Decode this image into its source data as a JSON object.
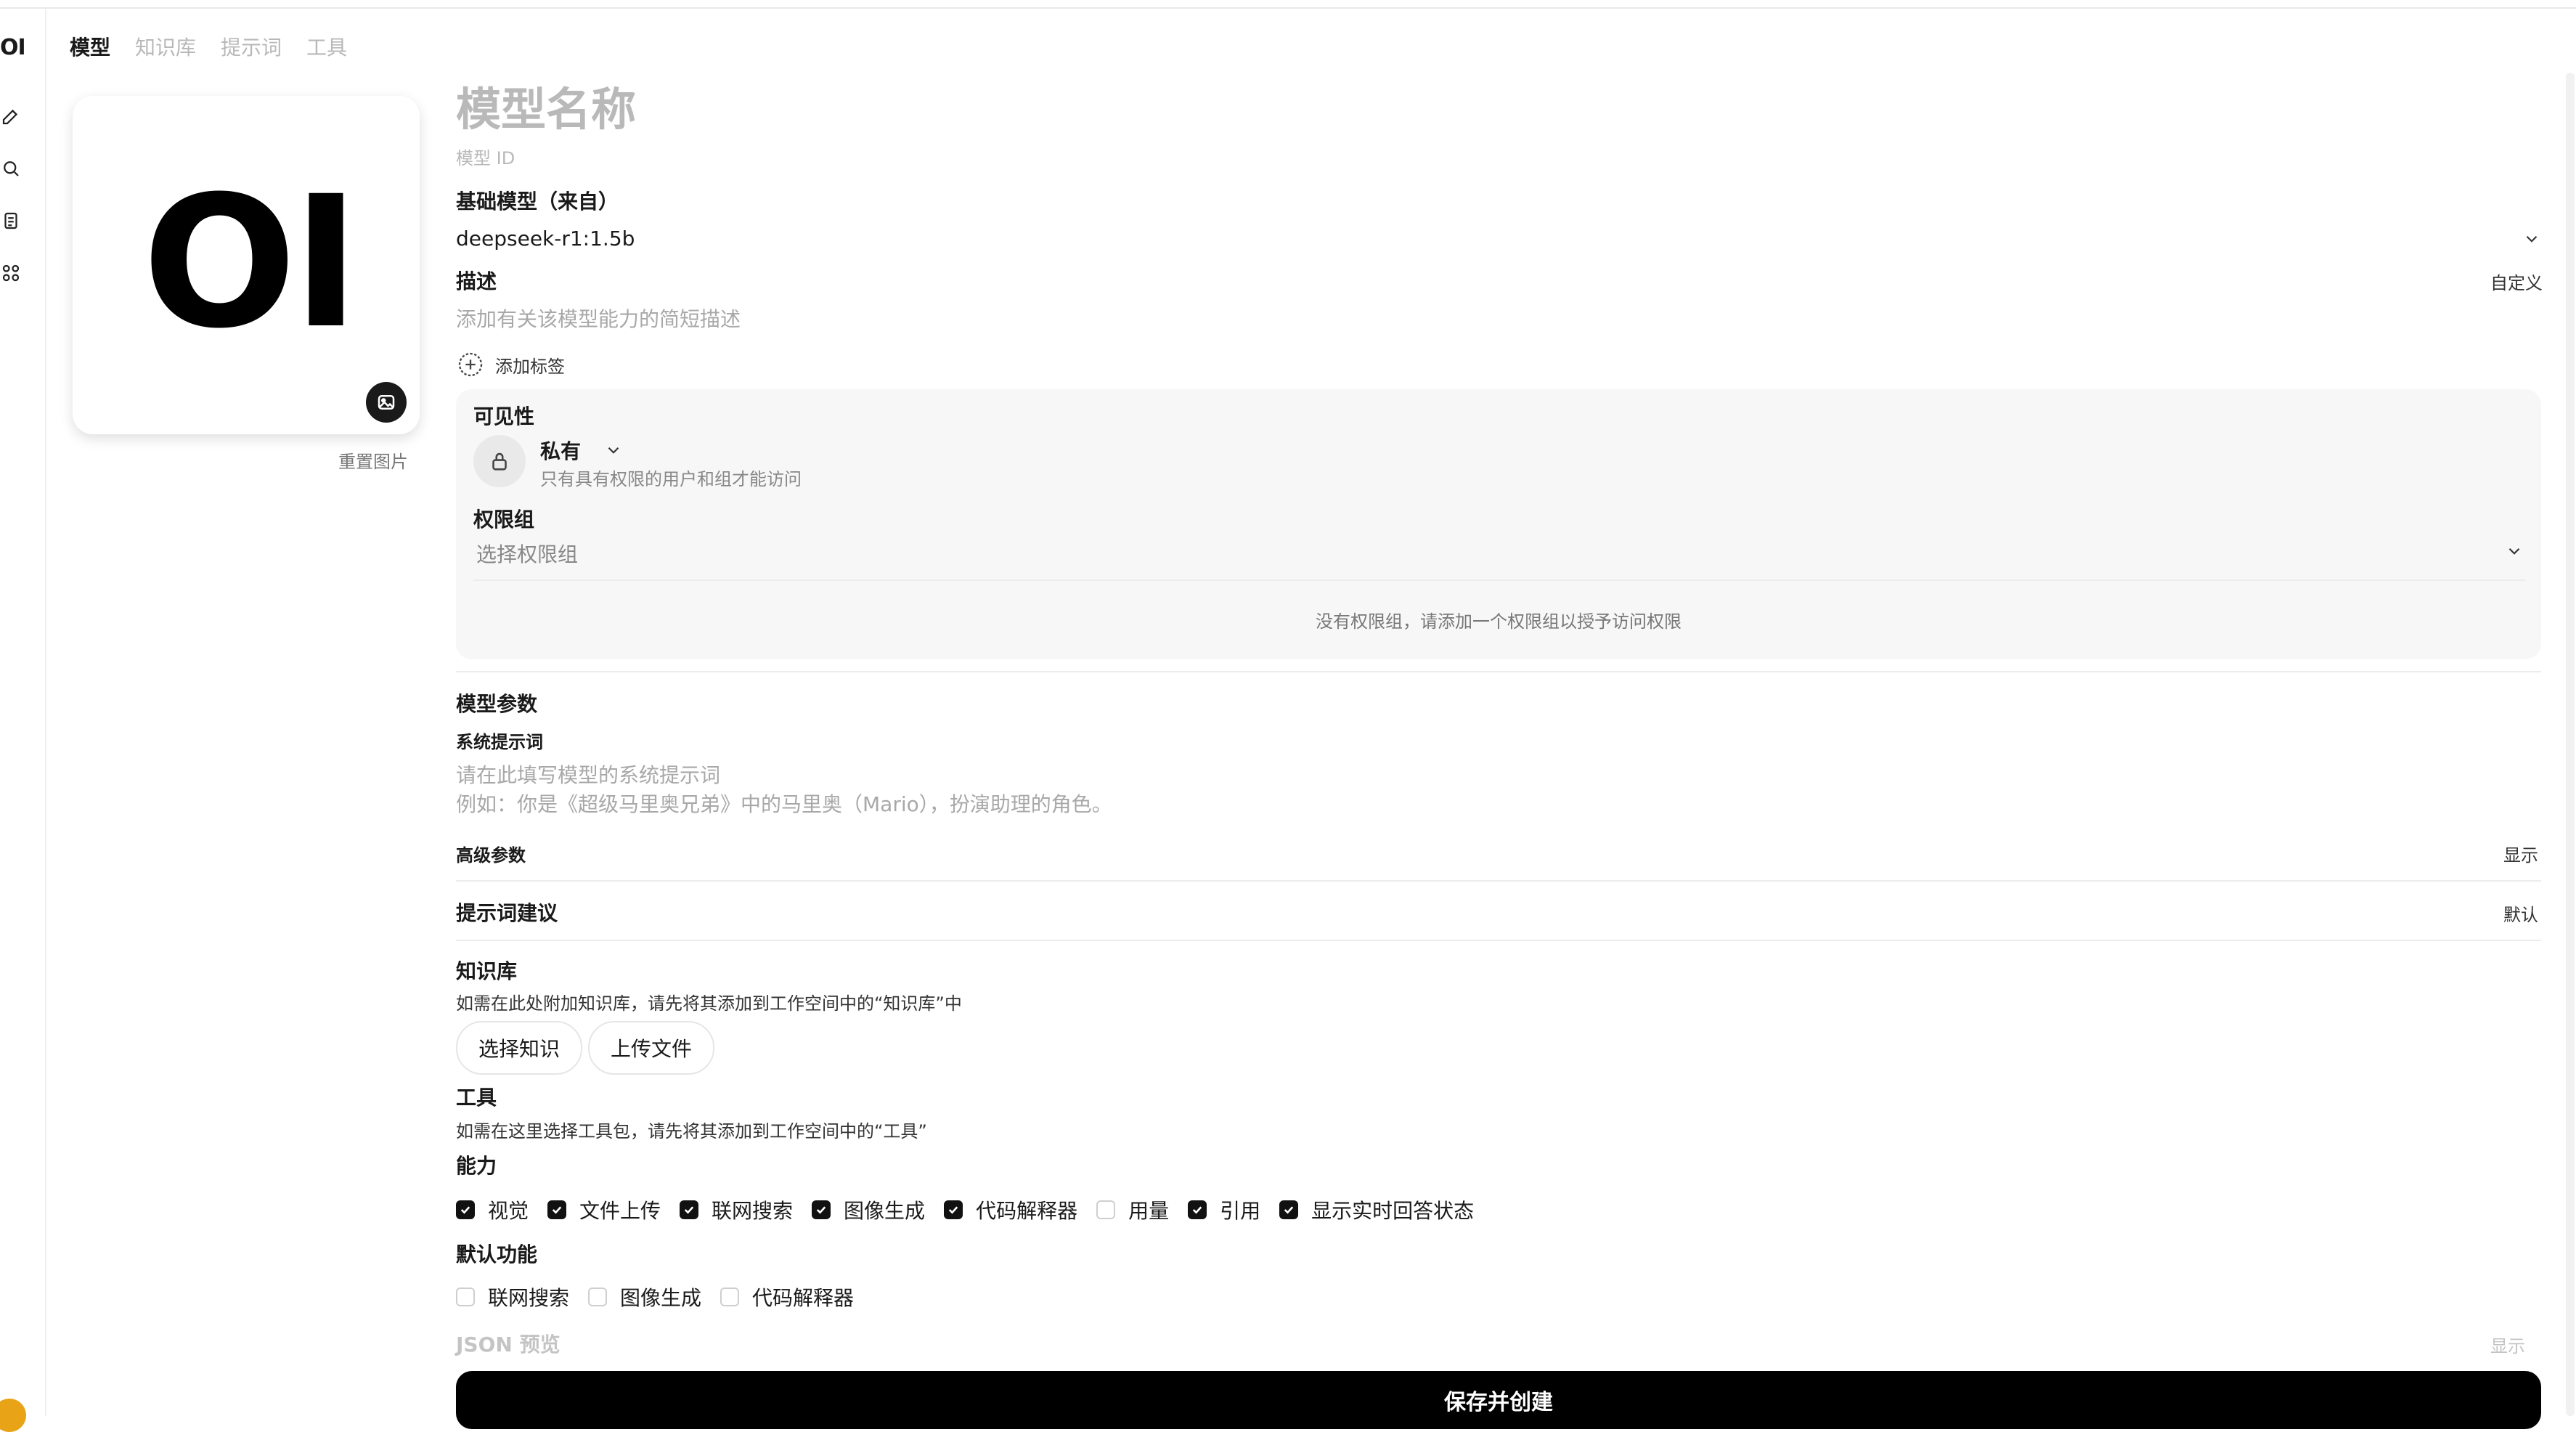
{
  "rail": {
    "logo": "OI",
    "icons": [
      "edit-icon",
      "search-icon",
      "notes-icon",
      "apps-icon"
    ]
  },
  "tabs": [
    {
      "label": "模型",
      "active": true
    },
    {
      "label": "知识库",
      "active": false
    },
    {
      "label": "提示词",
      "active": false
    },
    {
      "label": "工具",
      "active": false
    }
  ],
  "avatar": {
    "logo_text": "OI",
    "reset_label": "重置图片"
  },
  "form": {
    "name_placeholder": "模型名称",
    "id_placeholder": "模型 ID",
    "base_model_label": "基础模型（来自）",
    "base_model_value": "deepseek-r1:1.5b",
    "description_label": "描述",
    "description_mode": "自定义",
    "description_placeholder": "添加有关该模型能力的简短描述",
    "add_tag_label": "添加标签"
  },
  "visibility": {
    "label": "可见性",
    "value": "私有",
    "hint": "只有具有权限的用户和组才能访问",
    "group_label": "权限组",
    "group_placeholder": "选择权限组",
    "empty_text": "没有权限组，请添加一个权限组以授予访问权限"
  },
  "params": {
    "section_label": "模型参数",
    "system_prompt_label": "系统提示词",
    "system_prompt_placeholder": "请在此填写模型的系统提示词\n例如：你是《超级马里奥兄弟》中的马里奥（Mario），扮演助理的角色。",
    "advanced_label": "高级参数",
    "advanced_toggle": "显示"
  },
  "suggestions": {
    "label": "提示词建议",
    "mode": "默认"
  },
  "knowledge": {
    "label": "知识库",
    "hint": "如需在此处附加知识库，请先将其添加到工作空间中的“知识库”中",
    "select_button": "选择知识",
    "upload_button": "上传文件"
  },
  "tools": {
    "label": "工具",
    "hint": "如需在这里选择工具包，请先将其添加到工作空间中的“工具”"
  },
  "capabilities": {
    "label": "能力",
    "items": [
      {
        "label": "视觉",
        "checked": true
      },
      {
        "label": "文件上传",
        "checked": true
      },
      {
        "label": "联网搜索",
        "checked": true
      },
      {
        "label": "图像生成",
        "checked": true
      },
      {
        "label": "代码解释器",
        "checked": true
      },
      {
        "label": "用量",
        "checked": false
      },
      {
        "label": "引用",
        "checked": true
      },
      {
        "label": "显示实时回答状态",
        "checked": true
      }
    ]
  },
  "default_features": {
    "label": "默认功能",
    "items": [
      {
        "label": "联网搜索",
        "checked": false
      },
      {
        "label": "图像生成",
        "checked": false
      },
      {
        "label": "代码解释器",
        "checked": false
      }
    ]
  },
  "json_preview": {
    "label": "JSON 预览",
    "toggle": "显示"
  },
  "save_label": "保存并创建",
  "colors": {
    "accent": "#000000",
    "muted_text": "#b9b9b9",
    "panel_bg": "#f7f7f7",
    "user_avatar": "#e8a317"
  }
}
